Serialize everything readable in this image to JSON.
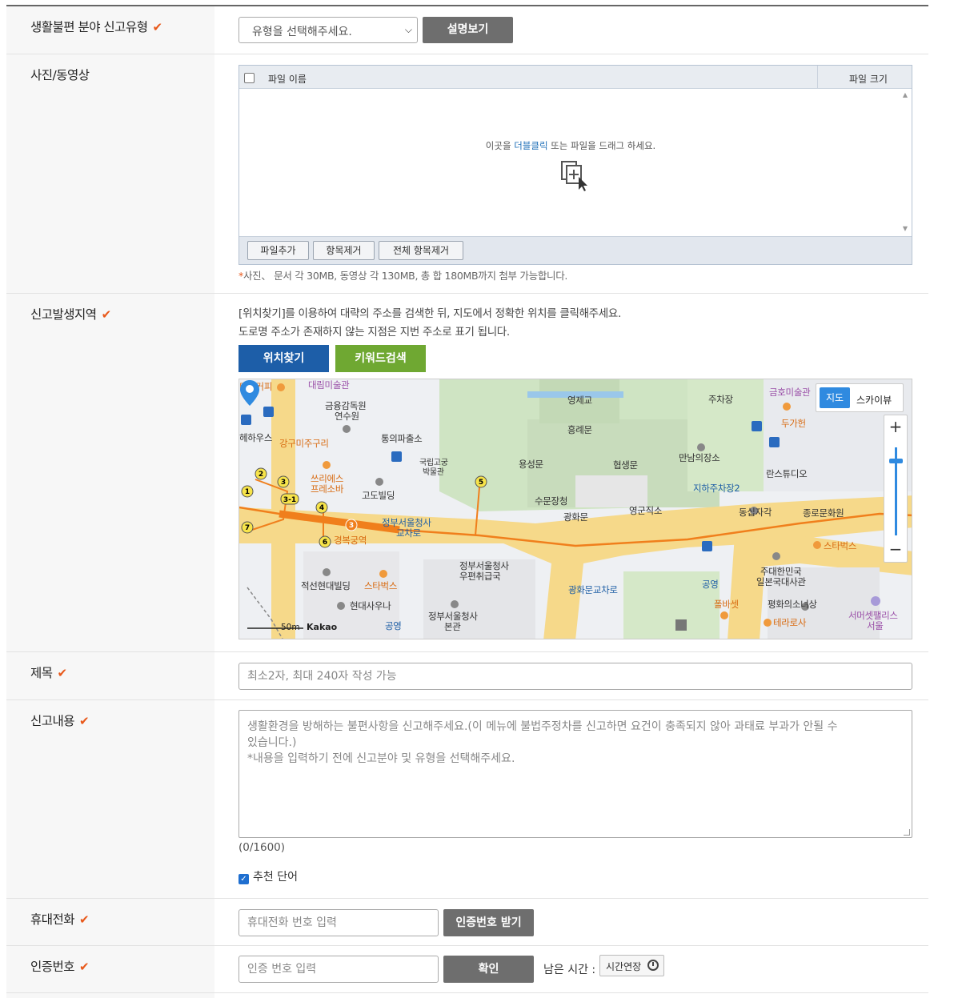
{
  "rows": {
    "type": {
      "label": "생활불편 분야 신고유형",
      "select_value": "유형을 선택해주세요.",
      "explain_button": "설명보기"
    },
    "media": {
      "label": "사진/동영상",
      "col_name": "파일 이름",
      "col_size": "파일 크기",
      "drop_text_pre": "이곳을 ",
      "drop_text_hl": "더블클릭",
      "drop_text_post": " 또는 파일을 드래그 하세요.",
      "buttons": {
        "add": "파일추가",
        "remove": "항목제거",
        "remove_all": "전체 항목제거"
      },
      "note_mark": "*",
      "note": "사진、 문서 각 30MB, 동영상 각 130MB, 총 합 180MB까지 첨부 가능합니다."
    },
    "area": {
      "label": "신고발생지역",
      "guide1": "[위치찾기]를 이용하여 대략의 주소를 검색한 뒤, 지도에서 정확한 위치를 클릭해주세요.",
      "guide2": "도로명 주소가 존재하지 않는 지점은 지번 주소로 표기 됩니다.",
      "find_button": "위치찾기",
      "keyword_button": "키워드검색",
      "map": {
        "type_map": "지도",
        "type_sky": "스카이뷰",
        "zoom_in": "+",
        "zoom_out": "−",
        "scale": "50m",
        "brand": "Kakao",
        "labels": {
          "tiam": "티암커피",
          "daerim": "대림미술관",
          "fss": "금융감독원",
          "fss2": "연수원",
          "heha": "헤하우스",
          "ganggu": "강구미주구리",
          "tongui": "통의파출소",
          "yeongje": "영제교",
          "heungnye": "흥례문",
          "museum": "국립고궁",
          "museum2": "박물관",
          "yongseong": "용성문",
          "hyeopsaeng": "협생문",
          "manan": "만남의장소",
          "parking": "주차장",
          "underparking": "지하주차장2",
          "kumho": "금호미술관",
          "dugahun": "두가헌",
          "sseurie": "쓰리에스",
          "sseurie2": "프레소바",
          "godo": "고도빌딩",
          "sumun": "수문장청",
          "gwanghwamun": "광화문",
          "yeonggun": "영군직소",
          "dongsip": "동십자각",
          "jongno": "종로문화원",
          "lans": "란스튜디오",
          "gov": "정부서울청사",
          "gov2": "교차로",
          "gyeongbok": "경복궁역",
          "starbucks1": "스타벅스",
          "starbucks2": "스타벅스",
          "post": "정부서울청사",
          "post2": "우편취급국",
          "jeoksun": "적선현대빌딩",
          "hyundai": "현대사우나",
          "park": "공영",
          "park2": "공영",
          "govmain": "정부서울청사",
          "govmain2": "본관",
          "intersection": "광화문교차로",
          "embassy": "주대한민국",
          "embassy2": "일본국대사관",
          "peace": "평화의소녀상",
          "pulbaset": "폴바셋",
          "terarosa": "테라로사",
          "palace": "서머셋팰리스",
          "palace2": "서울"
        }
      }
    },
    "title": {
      "label": "제목",
      "placeholder": "최소2자, 최대 240자 작성 가능"
    },
    "content": {
      "label": "신고내용",
      "placeholder_line1": "생활환경을 방해하는 불편사항을 신고해주세요.(이 메뉴에 불법주정차를 신고하면 요건이 충족되지 않아 과태료 부과가 안될 수",
      "placeholder_line2": "있습니다.)",
      "placeholder_line3": "*내용을 입력하기 전에 신고분야 및 유형을 선택해주세요.",
      "counter": "(0/1600)",
      "recommend": "추천 단어"
    },
    "phone": {
      "label": "휴대전화",
      "placeholder": "휴대전화 번호 입력",
      "button": "인증번호 받기"
    },
    "auth": {
      "label": "인증번호",
      "placeholder": "인증 번호 입력",
      "button": "확인",
      "remain": "남은 시간 :",
      "extend": "시간연장"
    }
  },
  "colors": {
    "required_mark": "#e8581a",
    "primary_blue": "#1d5ea8",
    "keyword_green": "#6fa832",
    "dark_button": "#6e6e6e"
  },
  "icons": {
    "required": "check-icon",
    "drop": "file-add-icon",
    "pin": "map-pin-icon",
    "clock": "clock-icon"
  }
}
